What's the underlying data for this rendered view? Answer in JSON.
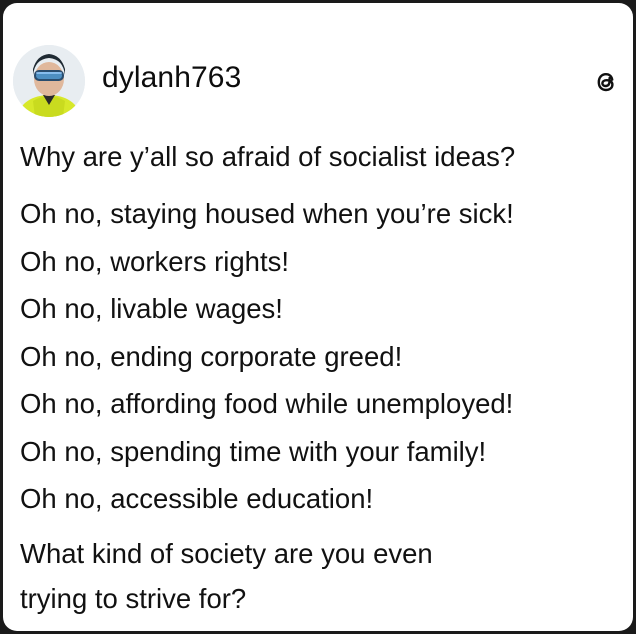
{
  "post": {
    "username": "dylanh763",
    "avatar_icon": "avatar-skier-icon",
    "brand_icon": "threads-logo-icon",
    "question": "Why are y’all so afraid of socialist ideas?",
    "lines": [
      "Oh no, staying housed when you’re sick!",
      "Oh no, workers rights!",
      "Oh no, livable wages!",
      "Oh no, ending corporate greed!",
      "Oh no, affording food while unemployed!",
      "Oh no, spending time with your family!",
      "Oh no, accessible education!"
    ],
    "closing_line_1": "What kind of society are you even",
    "closing_line_2": "trying to strive for?"
  },
  "colors": {
    "background": "#1a1a1a",
    "card": "#ffffff",
    "text": "#111111",
    "jacket": "#d7e82a"
  }
}
